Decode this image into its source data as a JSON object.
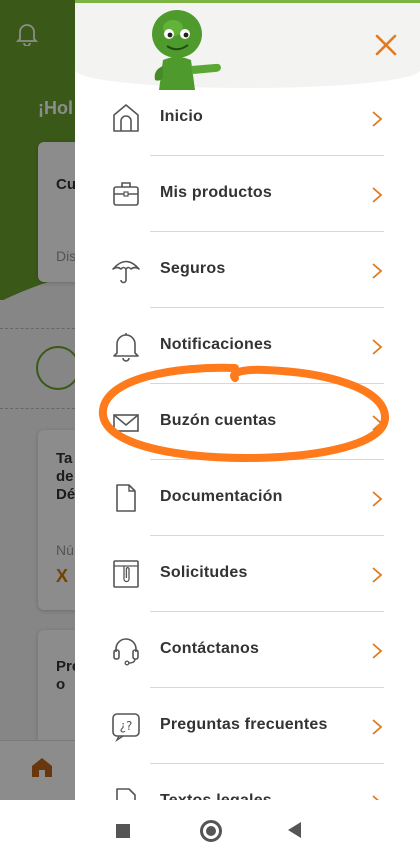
{
  "background": {
    "greeting": "¡Hol",
    "card1_title": "Cu",
    "card1_sub": "Dis",
    "card2_line1": "Ta",
    "card2_line2": "de",
    "card2_line3": "Dé",
    "card2_sub": "Nú",
    "card2_value": "X",
    "card3_line1": "Pre",
    "card3_line2": "o"
  },
  "menu": {
    "items": [
      {
        "label": "Inicio",
        "icon": "home-icon"
      },
      {
        "label": "Mis productos",
        "icon": "briefcase-icon"
      },
      {
        "label": "Seguros",
        "icon": "umbrella-icon"
      },
      {
        "label": "Notificaciones",
        "icon": "bell-icon"
      },
      {
        "label": "Buzón cuentas",
        "icon": "envelope-icon"
      },
      {
        "label": "Documentación",
        "icon": "document-icon"
      },
      {
        "label": "Solicitudes",
        "icon": "clip-folder-icon"
      },
      {
        "label": "Contáctanos",
        "icon": "headset-icon"
      },
      {
        "label": "Preguntas frecuentes",
        "icon": "question-bubble-icon"
      },
      {
        "label": "Textos legales",
        "icon": "legal-doc-icon"
      }
    ]
  },
  "colors": {
    "accent_orange": "#e07b22",
    "brand_green": "#6aa22c",
    "highlight_orange": "#ff7a1a"
  }
}
